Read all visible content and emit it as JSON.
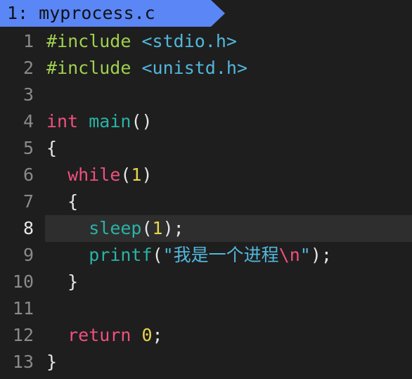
{
  "tab": {
    "number": "1:",
    "filename": "myprocess.c"
  },
  "lines": [
    {
      "n": "1",
      "tokens": [
        [
          "pp",
          "#include"
        ],
        [
          "pn",
          " "
        ],
        [
          "hdr",
          "<stdio.h>"
        ]
      ]
    },
    {
      "n": "2",
      "tokens": [
        [
          "pp",
          "#include"
        ],
        [
          "pn",
          " "
        ],
        [
          "hdr",
          "<unistd.h>"
        ]
      ]
    },
    {
      "n": "3",
      "tokens": []
    },
    {
      "n": "4",
      "tokens": [
        [
          "kw",
          "int"
        ],
        [
          "pn",
          " "
        ],
        [
          "fn",
          "main"
        ],
        [
          "pn",
          "()"
        ]
      ]
    },
    {
      "n": "5",
      "tokens": [
        [
          "pn",
          "{"
        ]
      ]
    },
    {
      "n": "6",
      "tokens": [
        [
          "pn",
          "  "
        ],
        [
          "kw",
          "while"
        ],
        [
          "pn",
          "("
        ],
        [
          "num",
          "1"
        ],
        [
          "pn",
          ")"
        ]
      ]
    },
    {
      "n": "7",
      "tokens": [
        [
          "pn",
          "  {"
        ]
      ]
    },
    {
      "n": "8",
      "current": true,
      "tokens": [
        [
          "pn",
          "    "
        ],
        [
          "fn",
          "sleep"
        ],
        [
          "pn",
          "("
        ],
        [
          "num",
          "1"
        ],
        [
          "pn",
          ");"
        ]
      ]
    },
    {
      "n": "9",
      "tokens": [
        [
          "pn",
          "    "
        ],
        [
          "fn",
          "printf"
        ],
        [
          "pn",
          "("
        ],
        [
          "str",
          "\"我是一个进程"
        ],
        [
          "esc",
          "\\n"
        ],
        [
          "str",
          "\""
        ],
        [
          "pn",
          ");"
        ]
      ]
    },
    {
      "n": "10",
      "tokens": [
        [
          "pn",
          "  }"
        ]
      ]
    },
    {
      "n": "11",
      "tokens": []
    },
    {
      "n": "12",
      "tokens": [
        [
          "pn",
          "  "
        ],
        [
          "kw",
          "return"
        ],
        [
          "pn",
          " "
        ],
        [
          "num",
          "0"
        ],
        [
          "pn",
          ";"
        ]
      ]
    },
    {
      "n": "13",
      "tokens": [
        [
          "pn",
          "}"
        ]
      ]
    }
  ],
  "colors": {
    "tab_background": "#5b86f5",
    "editor_background": "#1e1e1e",
    "current_line_background": "#2e2e2e",
    "preprocessor": "#9fd04e",
    "header": "#52b7dc",
    "keyword": "#f0507e",
    "function": "#29b3a7",
    "number": "#e8d44d"
  }
}
